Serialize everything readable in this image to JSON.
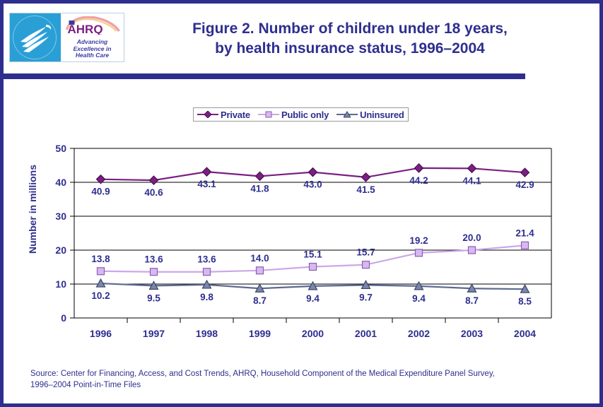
{
  "header": {
    "title_line1": "Figure 2. Number of children under 18 years,",
    "title_line2": "by health insurance status, 1996–2004",
    "logo": {
      "seal_name": "hhs-seal-icon",
      "ahrq_wordmark": "AHRQ",
      "tagline_line1": "Advancing",
      "tagline_line2": "Excellence in",
      "tagline_line3": "Health Care"
    }
  },
  "source": {
    "line1": "Source: Center for Financing, Access, and Cost Trends, AHRQ, Household Component of the Medical Expenditure Panel Survey,",
    "line2": "1996–2004 Point-in-Time Files"
  },
  "colors": {
    "frame": "#2e2e8f",
    "title": "#2e2e8f",
    "rule": "#2e2e8f",
    "private": "#7b1f82",
    "public": "#cba8e8",
    "public_marker_fill": "#d8b8f0",
    "uninsured": "#5d6a92",
    "uninsured_marker_fill": "#7a86ab",
    "axis": "#000000",
    "datalabel": "#2e2e8f"
  },
  "chart_data": {
    "type": "line",
    "title": "Figure 2. Number of children under 18 years, by health insurance status, 1996–2004",
    "xlabel": "",
    "ylabel": "Number in millions",
    "categories": [
      "1996",
      "1997",
      "1998",
      "1999",
      "2000",
      "2001",
      "2002",
      "2003",
      "2004"
    ],
    "ylim": [
      0,
      50
    ],
    "yticks": [
      "0",
      "10",
      "20",
      "30",
      "40",
      "50"
    ],
    "grid": true,
    "legend_position": "top-center",
    "series": [
      {
        "name": "Private",
        "marker": "diamond",
        "color": "#7b1f82",
        "values": [
          40.9,
          40.6,
          43.1,
          41.8,
          43.0,
          41.5,
          44.2,
          44.1,
          42.9
        ],
        "labels": [
          "40.9",
          "40.6",
          "43.1",
          "41.8",
          "43.0",
          "41.5",
          "44.2",
          "44.1",
          "42.9"
        ]
      },
      {
        "name": "Public only",
        "marker": "square",
        "color": "#cba8e8",
        "values": [
          13.8,
          13.6,
          13.6,
          14.0,
          15.1,
          15.7,
          19.2,
          20.0,
          21.4
        ],
        "labels": [
          "13.8",
          "13.6",
          "13.6",
          "14.0",
          "15.1",
          "15.7",
          "19.2",
          "20.0",
          "21.4"
        ]
      },
      {
        "name": "Uninsured",
        "marker": "triangle",
        "color": "#5d6a92",
        "values": [
          10.2,
          9.5,
          9.8,
          8.7,
          9.4,
          9.7,
          9.4,
          8.7,
          8.5
        ],
        "labels": [
          "10.2",
          "9.5",
          "9.8",
          "8.7",
          "9.4",
          "9.7",
          "9.4",
          "8.7",
          "8.5"
        ]
      }
    ]
  }
}
